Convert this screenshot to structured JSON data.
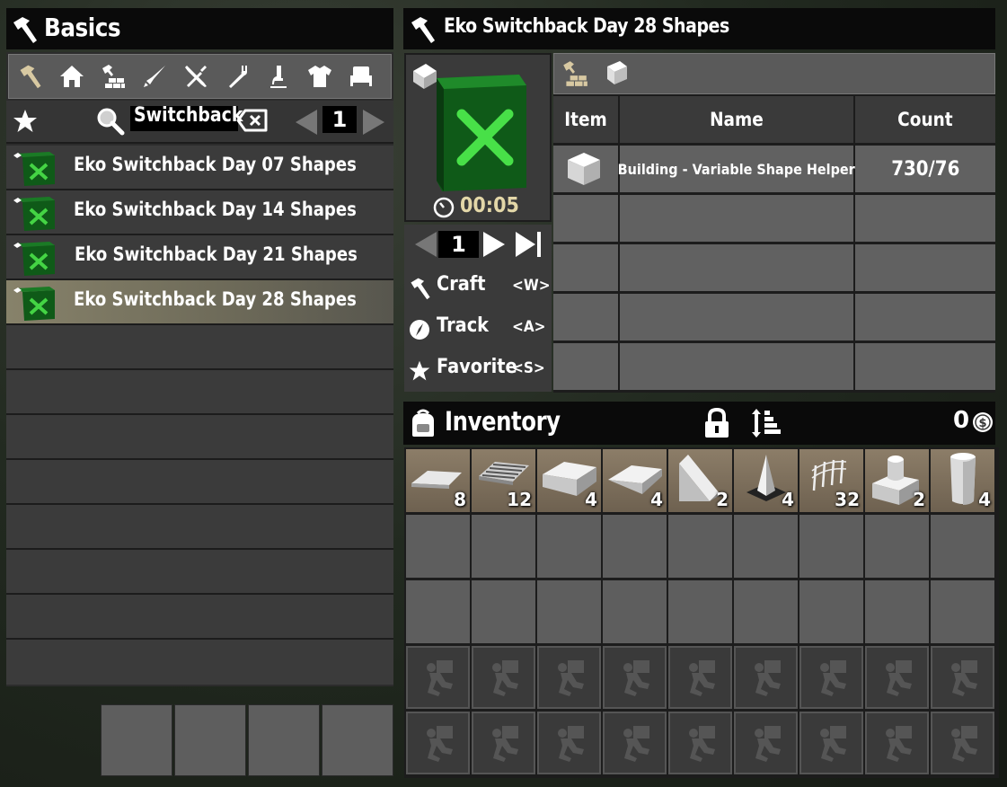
{
  "left_panel": {
    "title": "Basics",
    "categories": [
      "hammer-icon",
      "house-icon",
      "building-blocks-icon",
      "weapon-icon",
      "tools-icon",
      "fork-icon",
      "science-icon",
      "shirt-icon",
      "chair-icon"
    ],
    "search": {
      "value": "Switchback"
    },
    "page": "1",
    "recipes": [
      {
        "label": "Eko Switchback Day 07 Shapes"
      },
      {
        "label": "Eko Switchback Day 14 Shapes"
      },
      {
        "label": "Eko Switchback Day 21 Shapes"
      },
      {
        "label": "Eko Switchback Day 28 Shapes",
        "selected": true
      }
    ]
  },
  "recipe_panel": {
    "title": "Eko Switchback Day 28 Shapes",
    "time": "00:05",
    "quantity": "1",
    "actions": [
      {
        "label": "Craft",
        "key": "<W>",
        "icon": "hammer-icon"
      },
      {
        "label": "Track",
        "key": "<A>",
        "icon": "compass-icon"
      },
      {
        "label": "Favorite",
        "key": "<S>",
        "icon": "star-icon"
      }
    ],
    "ingredients": {
      "headers": [
        "Item",
        "Name",
        "Count"
      ],
      "rows": [
        {
          "name": "Building - Variable Shape Helper",
          "count": "730/76"
        }
      ]
    }
  },
  "inventory": {
    "title": "Inventory",
    "money": "0",
    "items": [
      {
        "icon": "ramp-plate-icon",
        "count": "8"
      },
      {
        "icon": "grate-icon",
        "count": "12"
      },
      {
        "icon": "slab-icon",
        "count": "4"
      },
      {
        "icon": "wedge-icon",
        "count": "4"
      },
      {
        "icon": "tall-wedge-icon",
        "count": "2"
      },
      {
        "icon": "pyramid-icon",
        "count": "4"
      },
      {
        "icon": "fence-icon",
        "count": "32"
      },
      {
        "icon": "pedestal-icon",
        "count": "2"
      },
      {
        "icon": "cylinder-icon",
        "count": "4"
      }
    ]
  },
  "colors": {
    "accent": "#d8c9a2",
    "selected_row": "#87826a",
    "slot": "#5e5e5e",
    "timer": "#e3d7a8"
  }
}
